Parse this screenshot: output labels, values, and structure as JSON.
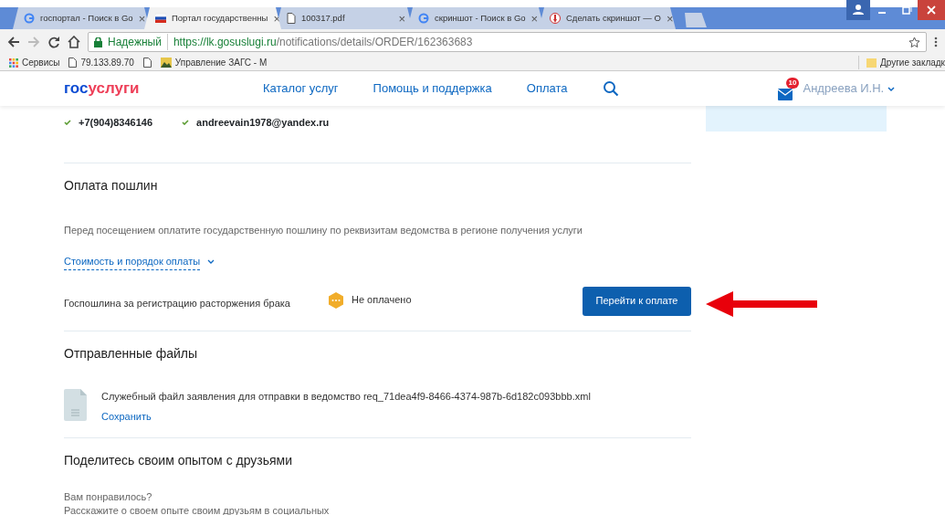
{
  "browser": {
    "tabs": [
      {
        "title": "госпортал - Поиск в Go",
        "kind": "google",
        "selected": false
      },
      {
        "title": "Портал государственны",
        "kind": "flag",
        "selected": true
      },
      {
        "title": "100317.pdf",
        "kind": "page",
        "selected": false
      },
      {
        "title": "скриншот - Поиск в Go",
        "kind": "google",
        "selected": false
      },
      {
        "title": "Сделать скриншот — О",
        "kind": "pin",
        "selected": false
      }
    ],
    "close_glyph": "×",
    "security_label": "Надежный",
    "url": {
      "scheme": "https://",
      "host": "lk.gosuslugi.ru",
      "path": "/notifications/details/ORDER/162363683"
    },
    "bookmarks": [
      {
        "kind": "apps",
        "label": "Сервисы"
      },
      {
        "kind": "page",
        "label": "79.133.89.70"
      },
      {
        "kind": "page"
      },
      {
        "kind": "image",
        "label": "Управление ЗАГС - М"
      }
    ],
    "other_bookmarks": "Другие закладк"
  },
  "site_header": {
    "logo": [
      {
        "text": "гос",
        "color": "#0d4cd3"
      },
      {
        "text": "услуги",
        "color": "#ee3f58"
      }
    ],
    "nav": [
      "Каталог услуг",
      "Помощь и поддержка",
      "Оплата"
    ],
    "notifications_count": "10",
    "user": "Андреева И.Н."
  },
  "contacts": [
    "+7(904)8346146",
    "andreevain1978@yandex.ru"
  ],
  "fees": {
    "title": "Оплата пошлин",
    "description": "Перед посещением оплатите государственную пошлину по реквизитам ведомства в регионе получения услуги",
    "details_link": "Стоимость и порядок оплаты",
    "items": [
      {
        "name": "Госпошлина за регистрацию расторжения брака",
        "status": "Не оплачено",
        "paid": false,
        "button": "Перейти к оплате"
      }
    ]
  },
  "files": {
    "title": "Отправленные файлы",
    "items": [
      {
        "name": "Служебный файл заявления для отправки в ведомство req_71dea4f9-8466-4374-987b-6d182c093bbb.xml",
        "action": "Сохранить"
      }
    ]
  },
  "share": {
    "title": "Поделитесь своим опытом с друзьями",
    "lines": [
      "Вам понравилось?",
      "Расскажите о своем опыте своим друзьям в социальных"
    ]
  }
}
